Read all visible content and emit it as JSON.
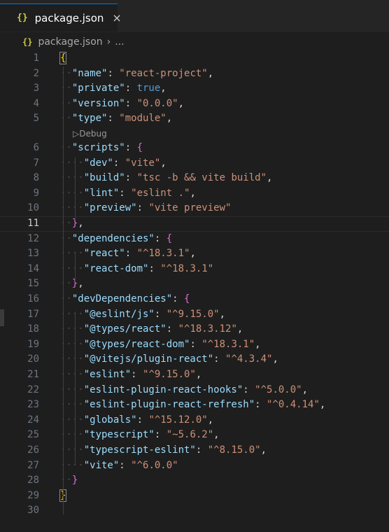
{
  "tab": {
    "icon": "json-braces-icon",
    "braces": "{}",
    "title": "package.json",
    "close": "×"
  },
  "breadcrumb": {
    "icon": "json-braces-icon",
    "braces": "{}",
    "file": "package.json",
    "separator": "›",
    "ellipsis": "..."
  },
  "codelens": {
    "label": "Debug",
    "icon": "play-icon"
  },
  "current_line": 11,
  "lines": [
    {
      "n": "1",
      "tokens": [
        {
          "t": "{",
          "c": "b1 bracketbox"
        }
      ]
    },
    {
      "n": "2",
      "tokens": [
        {
          "t": "··",
          "c": "ws"
        },
        {
          "t": "\"name\"",
          "c": "k"
        },
        {
          "t": ": ",
          "c": "p"
        },
        {
          "t": "\"react-project\"",
          "c": "s"
        },
        {
          "t": ",",
          "c": "p"
        }
      ]
    },
    {
      "n": "3",
      "tokens": [
        {
          "t": "··",
          "c": "ws"
        },
        {
          "t": "\"private\"",
          "c": "k"
        },
        {
          "t": ": ",
          "c": "p"
        },
        {
          "t": "true",
          "c": "kw"
        },
        {
          "t": ",",
          "c": "p"
        }
      ]
    },
    {
      "n": "4",
      "tokens": [
        {
          "t": "··",
          "c": "ws"
        },
        {
          "t": "\"version\"",
          "c": "k"
        },
        {
          "t": ": ",
          "c": "p"
        },
        {
          "t": "\"0.0.0\"",
          "c": "s"
        },
        {
          "t": ",",
          "c": "p"
        }
      ]
    },
    {
      "n": "5",
      "tokens": [
        {
          "t": "··",
          "c": "ws"
        },
        {
          "t": "\"type\"",
          "c": "k"
        },
        {
          "t": ": ",
          "c": "p"
        },
        {
          "t": "\"module\"",
          "c": "s"
        },
        {
          "t": ",",
          "c": "p"
        }
      ]
    },
    {
      "n": "6",
      "tokens": [
        {
          "t": "··",
          "c": "ws"
        },
        {
          "t": "\"scripts\"",
          "c": "k"
        },
        {
          "t": ": ",
          "c": "p"
        },
        {
          "t": "{",
          "c": "b2"
        }
      ]
    },
    {
      "n": "7",
      "tokens": [
        {
          "t": "····",
          "c": "ws"
        },
        {
          "t": "\"dev\"",
          "c": "k"
        },
        {
          "t": ": ",
          "c": "p"
        },
        {
          "t": "\"vite\"",
          "c": "s"
        },
        {
          "t": ",",
          "c": "p"
        }
      ]
    },
    {
      "n": "8",
      "tokens": [
        {
          "t": "····",
          "c": "ws"
        },
        {
          "t": "\"build\"",
          "c": "k"
        },
        {
          "t": ": ",
          "c": "p"
        },
        {
          "t": "\"tsc -b && vite build\"",
          "c": "s"
        },
        {
          "t": ",",
          "c": "p"
        }
      ]
    },
    {
      "n": "9",
      "tokens": [
        {
          "t": "····",
          "c": "ws"
        },
        {
          "t": "\"lint\"",
          "c": "k"
        },
        {
          "t": ": ",
          "c": "p"
        },
        {
          "t": "\"eslint .\"",
          "c": "s"
        },
        {
          "t": ",",
          "c": "p"
        }
      ]
    },
    {
      "n": "10",
      "tokens": [
        {
          "t": "····",
          "c": "ws"
        },
        {
          "t": "\"preview\"",
          "c": "k"
        },
        {
          "t": ": ",
          "c": "p"
        },
        {
          "t": "\"vite preview\"",
          "c": "s"
        }
      ]
    },
    {
      "n": "11",
      "tokens": [
        {
          "t": "··",
          "c": "ws"
        },
        {
          "t": "}",
          "c": "b2"
        },
        {
          "t": ",",
          "c": "p"
        }
      ]
    },
    {
      "n": "12",
      "tokens": [
        {
          "t": "··",
          "c": "ws"
        },
        {
          "t": "\"dependencies\"",
          "c": "k"
        },
        {
          "t": ": ",
          "c": "p"
        },
        {
          "t": "{",
          "c": "b2"
        }
      ]
    },
    {
      "n": "13",
      "tokens": [
        {
          "t": "····",
          "c": "ws"
        },
        {
          "t": "\"react\"",
          "c": "k"
        },
        {
          "t": ": ",
          "c": "p"
        },
        {
          "t": "\"^18.3.1\"",
          "c": "s"
        },
        {
          "t": ",",
          "c": "p"
        }
      ]
    },
    {
      "n": "14",
      "tokens": [
        {
          "t": "····",
          "c": "ws"
        },
        {
          "t": "\"react-dom\"",
          "c": "k"
        },
        {
          "t": ": ",
          "c": "p"
        },
        {
          "t": "\"^18.3.1\"",
          "c": "s"
        }
      ]
    },
    {
      "n": "15",
      "tokens": [
        {
          "t": "··",
          "c": "ws"
        },
        {
          "t": "}",
          "c": "b2"
        },
        {
          "t": ",",
          "c": "p"
        }
      ]
    },
    {
      "n": "16",
      "tokens": [
        {
          "t": "··",
          "c": "ws"
        },
        {
          "t": "\"devDependencies\"",
          "c": "k"
        },
        {
          "t": ": ",
          "c": "p"
        },
        {
          "t": "{",
          "c": "b2"
        }
      ]
    },
    {
      "n": "17",
      "tokens": [
        {
          "t": "····",
          "c": "ws"
        },
        {
          "t": "\"@eslint/js\"",
          "c": "k"
        },
        {
          "t": ": ",
          "c": "p"
        },
        {
          "t": "\"^9.15.0\"",
          "c": "s"
        },
        {
          "t": ",",
          "c": "p"
        }
      ]
    },
    {
      "n": "18",
      "tokens": [
        {
          "t": "····",
          "c": "ws"
        },
        {
          "t": "\"@types/react\"",
          "c": "k"
        },
        {
          "t": ": ",
          "c": "p"
        },
        {
          "t": "\"^18.3.12\"",
          "c": "s"
        },
        {
          "t": ",",
          "c": "p"
        }
      ]
    },
    {
      "n": "19",
      "tokens": [
        {
          "t": "····",
          "c": "ws"
        },
        {
          "t": "\"@types/react-dom\"",
          "c": "k"
        },
        {
          "t": ": ",
          "c": "p"
        },
        {
          "t": "\"^18.3.1\"",
          "c": "s"
        },
        {
          "t": ",",
          "c": "p"
        }
      ]
    },
    {
      "n": "20",
      "tokens": [
        {
          "t": "····",
          "c": "ws"
        },
        {
          "t": "\"@vitejs/plugin-react\"",
          "c": "k"
        },
        {
          "t": ": ",
          "c": "p"
        },
        {
          "t": "\"^4.3.4\"",
          "c": "s"
        },
        {
          "t": ",",
          "c": "p"
        }
      ]
    },
    {
      "n": "21",
      "tokens": [
        {
          "t": "····",
          "c": "ws"
        },
        {
          "t": "\"eslint\"",
          "c": "k"
        },
        {
          "t": ": ",
          "c": "p"
        },
        {
          "t": "\"^9.15.0\"",
          "c": "s"
        },
        {
          "t": ",",
          "c": "p"
        }
      ]
    },
    {
      "n": "22",
      "tokens": [
        {
          "t": "····",
          "c": "ws"
        },
        {
          "t": "\"eslint-plugin-react-hooks\"",
          "c": "k"
        },
        {
          "t": ": ",
          "c": "p"
        },
        {
          "t": "\"^5.0.0\"",
          "c": "s"
        },
        {
          "t": ",",
          "c": "p"
        }
      ]
    },
    {
      "n": "23",
      "tokens": [
        {
          "t": "····",
          "c": "ws"
        },
        {
          "t": "\"eslint-plugin-react-refresh\"",
          "c": "k"
        },
        {
          "t": ": ",
          "c": "p"
        },
        {
          "t": "\"^0.4.14\"",
          "c": "s"
        },
        {
          "t": ",",
          "c": "p"
        }
      ]
    },
    {
      "n": "24",
      "tokens": [
        {
          "t": "····",
          "c": "ws"
        },
        {
          "t": "\"globals\"",
          "c": "k"
        },
        {
          "t": ": ",
          "c": "p"
        },
        {
          "t": "\"^15.12.0\"",
          "c": "s"
        },
        {
          "t": ",",
          "c": "p"
        }
      ]
    },
    {
      "n": "25",
      "tokens": [
        {
          "t": "····",
          "c": "ws"
        },
        {
          "t": "\"typescript\"",
          "c": "k"
        },
        {
          "t": ": ",
          "c": "p"
        },
        {
          "t": "\"~5.6.2\"",
          "c": "s"
        },
        {
          "t": ",",
          "c": "p"
        }
      ]
    },
    {
      "n": "26",
      "tokens": [
        {
          "t": "····",
          "c": "ws"
        },
        {
          "t": "\"typescript-eslint\"",
          "c": "k"
        },
        {
          "t": ": ",
          "c": "p"
        },
        {
          "t": "\"^8.15.0\"",
          "c": "s"
        },
        {
          "t": ",",
          "c": "p"
        }
      ]
    },
    {
      "n": "27",
      "tokens": [
        {
          "t": "····",
          "c": "ws"
        },
        {
          "t": "\"vite\"",
          "c": "k"
        },
        {
          "t": ": ",
          "c": "p"
        },
        {
          "t": "\"^6.0.0\"",
          "c": "s"
        }
      ]
    },
    {
      "n": "28",
      "tokens": [
        {
          "t": "··",
          "c": "ws"
        },
        {
          "t": "}",
          "c": "b2"
        }
      ]
    },
    {
      "n": "29",
      "tokens": [
        {
          "t": "}",
          "c": "b1 bracketbox"
        }
      ]
    },
    {
      "n": "30",
      "tokens": []
    }
  ]
}
